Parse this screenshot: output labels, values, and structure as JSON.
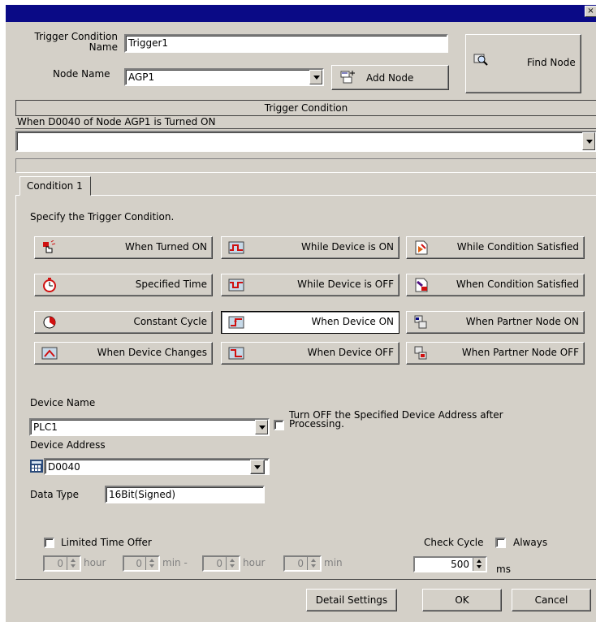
{
  "dialog": {
    "close_glyph": "×"
  },
  "header": {
    "trigger_name_label": "Trigger Condition\nName",
    "trigger_name_value": "Trigger1",
    "node_name_label": "Node Name",
    "node_name_value": "AGP1",
    "add_node_label": "Add Node",
    "find_node_label": "Find Node"
  },
  "trigger_panel": {
    "header": "Trigger Condition",
    "summary": "When D0040 of Node AGP1 is Turned ON",
    "expression_value": ""
  },
  "tabs": [
    {
      "label": "Condition 1",
      "active": true
    }
  ],
  "condition": {
    "instruction": "Specify the Trigger Condition.",
    "buttons": [
      {
        "label": "When Turned ON",
        "icon": "hand-pointer-icon"
      },
      {
        "label": "While Device is ON",
        "icon": "device-on-icon"
      },
      {
        "label": "While Condition Satisfied",
        "icon": "condition-flag-icon"
      },
      {
        "label": "Specified Time",
        "icon": "timer-icon"
      },
      {
        "label": "While Device is OFF",
        "icon": "device-off-icon"
      },
      {
        "label": "When Condition Satisfied",
        "icon": "condition-ok-icon"
      },
      {
        "label": "Constant Cycle",
        "icon": "cycle-clock-icon"
      },
      {
        "label": "When Device ON",
        "icon": "device-rise-icon",
        "selected": true
      },
      {
        "label": "When Partner Node ON",
        "icon": "partner-node-on-icon"
      },
      {
        "label": "When Device Changes",
        "icon": "device-change-icon"
      },
      {
        "label": "When Device OFF",
        "icon": "device-fall-icon"
      },
      {
        "label": "When Partner Node OFF",
        "icon": "partner-node-off-icon"
      }
    ]
  },
  "device": {
    "device_name_label": "Device Name",
    "device_name_value": "PLC1",
    "turn_off_label": "Turn OFF the Specified Device Address after\nProcessing.",
    "turn_off_checked": false,
    "device_address_label": "Device Address",
    "device_address_value": "D0040",
    "data_type_label": "Data Type",
    "data_type_value": "16Bit(Signed)"
  },
  "timing": {
    "limited_time_label": "Limited Time Offer",
    "limited_time_checked": false,
    "spinners": [
      {
        "value": "0",
        "unit": "hour"
      },
      {
        "value": "0",
        "unit": "min -"
      },
      {
        "value": "0",
        "unit": "hour"
      },
      {
        "value": "0",
        "unit": "min"
      }
    ],
    "check_cycle_label": "Check Cycle",
    "always_label": "Always",
    "always_checked": false,
    "check_cycle_value": "500",
    "check_cycle_unit": "ms"
  },
  "footer": {
    "detail_settings_label": "Detail Settings",
    "ok_label": "OK",
    "cancel_label": "Cancel"
  }
}
